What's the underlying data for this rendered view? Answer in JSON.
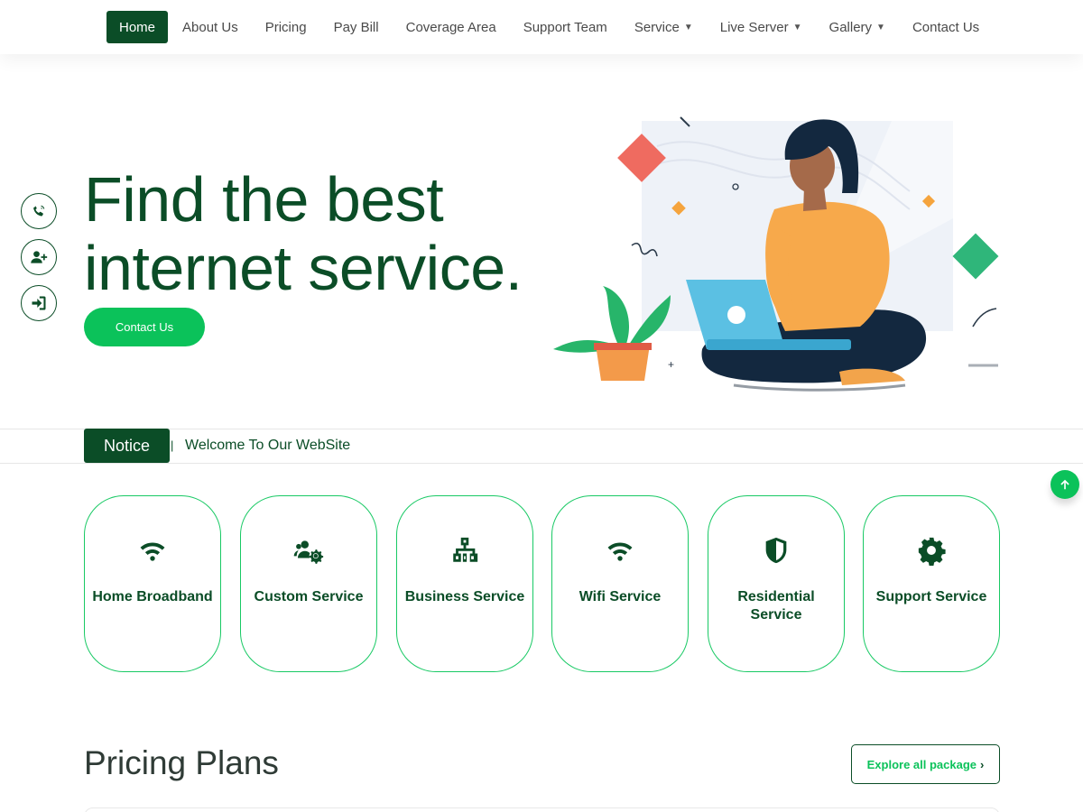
{
  "nav": {
    "items": [
      {
        "label": "Home",
        "active": true
      },
      {
        "label": "About Us"
      },
      {
        "label": "Pricing"
      },
      {
        "label": "Pay Bill"
      },
      {
        "label": "Coverage Area"
      },
      {
        "label": "Support Team"
      },
      {
        "label": "Service",
        "dropdown": true
      },
      {
        "label": "Live Server",
        "dropdown": true
      },
      {
        "label": "Gallery",
        "dropdown": true
      },
      {
        "label": "Contact Us"
      }
    ],
    "caret": "▼"
  },
  "side_icons": [
    "phone-call-icon",
    "user-plus-icon",
    "sign-in-icon"
  ],
  "hero": {
    "title_line1": "Find the best",
    "title_line2": "internet service.",
    "button_label": "Contact Us"
  },
  "notice": {
    "badge": "Notice",
    "separator": "|",
    "message": "Welcome To Our WebSite"
  },
  "services": [
    {
      "label": "Home Broadband",
      "icon": "wifi-icon"
    },
    {
      "label": "Custom Service",
      "icon": "users-cog-icon"
    },
    {
      "label": "Business Service",
      "icon": "network-icon"
    },
    {
      "label": "Wifi Service",
      "icon": "wifi-icon"
    },
    {
      "label": "Residential Service",
      "icon": "shield-icon"
    },
    {
      "label": "Support Service",
      "icon": "gear-icon"
    }
  ],
  "pricing": {
    "title": "Pricing Plans",
    "explore_label": "Explore all package",
    "explore_chevron": "›"
  },
  "colors": {
    "primary_dark": "#0b4d27",
    "accent_green": "#0bc25a",
    "card_border": "#18c964"
  }
}
